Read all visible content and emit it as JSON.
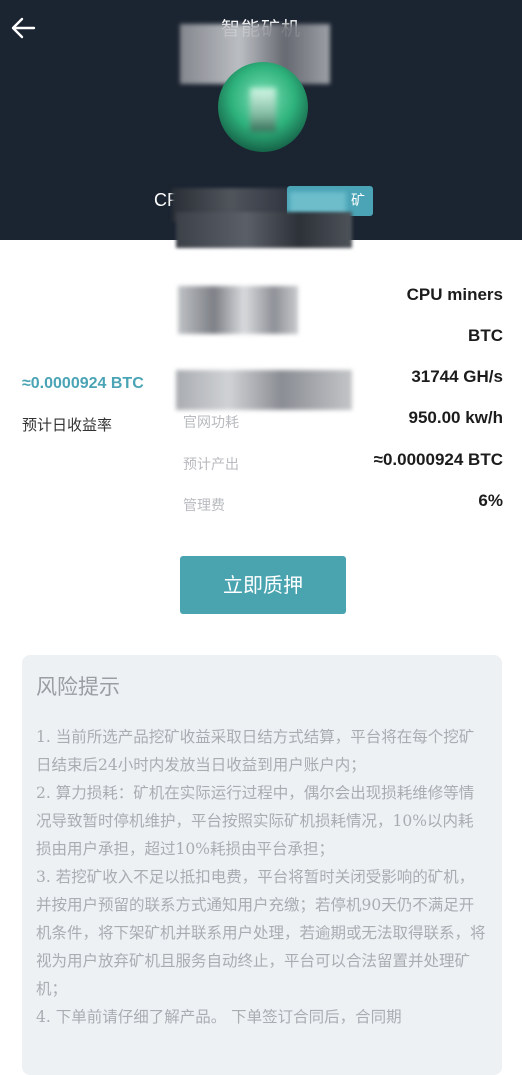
{
  "header": {
    "title": "智能矿机",
    "product_name_visible": "CP",
    "tag_suffix": "矿"
  },
  "summary": {
    "daily_yield_value": "≈0.0000924 BTC",
    "daily_yield_label": "预计日收益率"
  },
  "specs": [
    {
      "key": "",
      "value": "CPU miners"
    },
    {
      "key": "",
      "value": "BTC"
    },
    {
      "key": "",
      "value": "31744 GH/s"
    },
    {
      "key": "官网功耗",
      "value": "950.00 kw/h"
    },
    {
      "key": "预计产出",
      "value": "≈0.0000924 BTC"
    },
    {
      "key": "管理费",
      "value": "6%"
    }
  ],
  "actions": {
    "stake_label": "立即质押"
  },
  "risk": {
    "title": "风险提示",
    "paragraphs": [
      "1. 当前所选产品挖矿收益采取日结方式结算，平台将在每个挖矿日结束后24小时内发放当日收益到用户账户内；",
      "2. 算力损耗：矿机在实际运行过程中，偶尔会出现损耗维修等情况导致暂时停机维护，平台按照实际矿机损耗情况，10%以内耗损由用户承担，超过10%耗损由平台承担；",
      "3. 若挖矿收入不足以抵扣电费，平台将暂时关闭受影响的矿机，并按用户预留的联系方式通知用户充缴；若停机90天仍不满足开机条件，将下架矿机并联系用户处理，若逾期或无法取得联系，将视为用户放弃矿机且服务自动终止，平台可以合法留置并处理矿机；",
      "4. 下单前请仔细了解产品。 下单签订合同后，合同期"
    ]
  },
  "icons": {
    "back": "arrow-left-icon"
  }
}
